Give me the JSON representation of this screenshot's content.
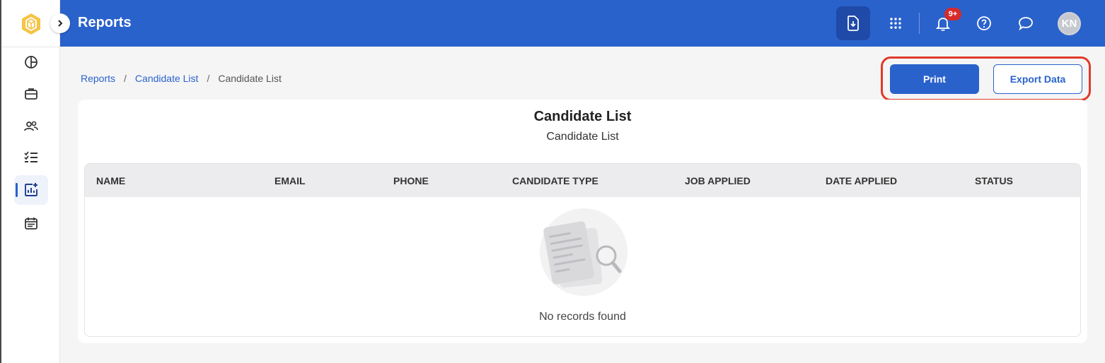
{
  "header": {
    "title": "Reports",
    "notification_badge": "9+",
    "avatar_initials": "KN",
    "icons": [
      "download-report-icon",
      "apps-grid-icon",
      "bell-icon",
      "help-icon",
      "chat-icon"
    ]
  },
  "sidebar": {
    "items": [
      {
        "name": "dashboard",
        "icon": "pie-chart-icon"
      },
      {
        "name": "jobs",
        "icon": "briefcase-icon"
      },
      {
        "name": "candidates",
        "icon": "users-icon"
      },
      {
        "name": "tasks",
        "icon": "checklist-icon"
      },
      {
        "name": "reports",
        "icon": "report-chart-icon",
        "active": true
      },
      {
        "name": "calendar",
        "icon": "calendar-icon"
      }
    ]
  },
  "breadcrumb": {
    "items": [
      "Reports",
      "Candidate List",
      "Candidate List"
    ],
    "separator": "/"
  },
  "actions": {
    "print_label": "Print",
    "export_label": "Export Data"
  },
  "report": {
    "title": "Candidate List",
    "subtitle": "Candidate List",
    "columns": [
      "NAME",
      "EMAIL",
      "PHONE",
      "CANDIDATE TYPE",
      "JOB APPLIED",
      "DATE APPLIED",
      "STATUS"
    ],
    "empty_message": "No records found"
  },
  "colors": {
    "primary": "#2a62cc",
    "highlight": "#e03a2a",
    "badge": "#d62b2b"
  }
}
